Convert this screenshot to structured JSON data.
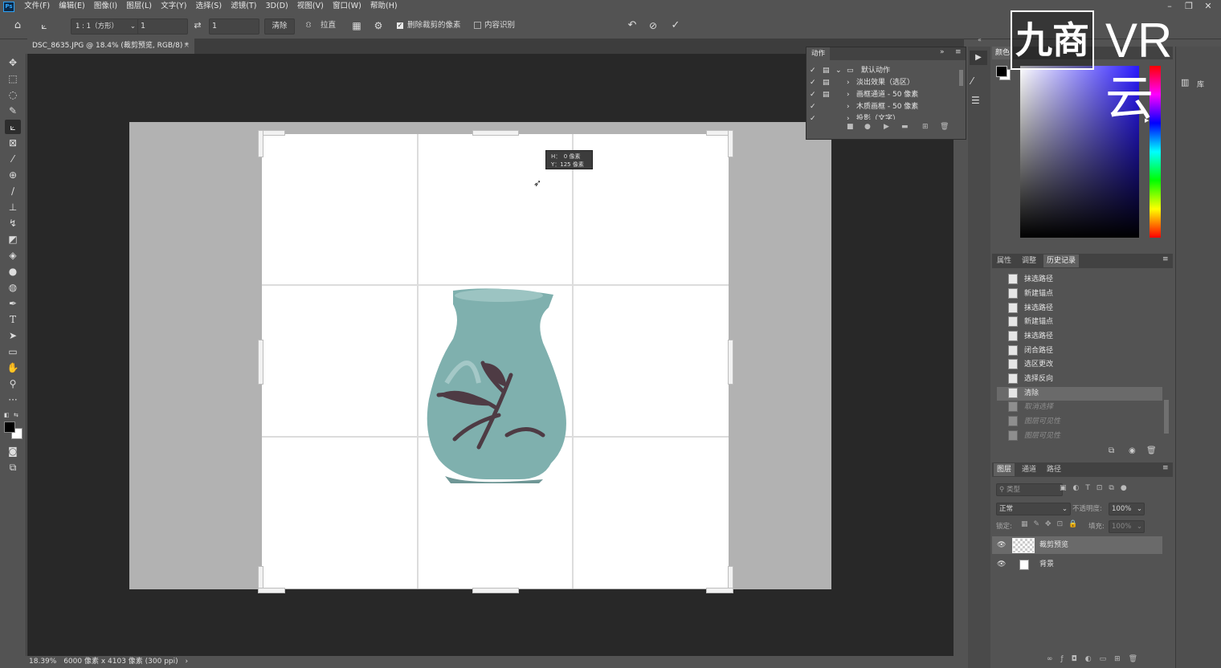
{
  "app": {
    "logo": "Ps"
  },
  "menu": [
    "文件(F)",
    "编辑(E)",
    "图像(I)",
    "图层(L)",
    "文字(Y)",
    "选择(S)",
    "滤镜(T)",
    "3D(D)",
    "视图(V)",
    "窗口(W)",
    "帮助(H)"
  ],
  "options": {
    "ratio_label": "1 : 1（方形）",
    "ratio_w": "1",
    "ratio_h": "1",
    "clear_label": "清除",
    "straighten_label": "拉直",
    "delete_cropped_label": "删除裁剪的像素",
    "delete_cropped_checked": true,
    "content_aware_label": "内容识别",
    "content_aware_checked": false
  },
  "document": {
    "tab_label": "DSC_8635.JPG @ 18.4% (裁剪预览, RGB/8) *",
    "tooltip_line1": "H：　0 像素",
    "tooltip_line2": "Y：125 像素"
  },
  "status": {
    "zoom": "18.39%",
    "info": "6000 像素 x 4103 像素 (300 ppi)"
  },
  "actions_panel": {
    "title": "动作",
    "rows": [
      {
        "label": "默认动作",
        "checked": true,
        "type": "folder"
      },
      {
        "label": "淡出效果（选区）",
        "checked": true,
        "type": "action"
      },
      {
        "label": "画框通道 - 50 像素",
        "checked": true,
        "type": "action"
      },
      {
        "label": "木质画框 - 50 像素",
        "checked": true,
        "type": "action"
      },
      {
        "label": "投影（文字）",
        "checked": true,
        "type": "action"
      }
    ]
  },
  "color_panel": {
    "tabs": [
      "颜色"
    ],
    "fg": "#000000",
    "bg": "#ffffff"
  },
  "watermark": {
    "text_left": "九商",
    "text_right": "VR云"
  },
  "history_panel": {
    "tabs": [
      "属性",
      "调整",
      "历史记录"
    ],
    "active_tab": "历史记录",
    "rows": [
      {
        "label": "抹选路径",
        "state": "normal"
      },
      {
        "label": "新建锚点",
        "state": "normal"
      },
      {
        "label": "抹选路径",
        "state": "normal"
      },
      {
        "label": "新建锚点",
        "state": "normal"
      },
      {
        "label": "抹选路径",
        "state": "normal"
      },
      {
        "label": "闭合路径",
        "state": "normal"
      },
      {
        "label": "选区更改",
        "state": "normal"
      },
      {
        "label": "选择反向",
        "state": "normal"
      },
      {
        "label": "清除",
        "state": "selected"
      },
      {
        "label": "取消选择",
        "state": "dim"
      },
      {
        "label": "图层可见性",
        "state": "dim"
      },
      {
        "label": "图层可见性",
        "state": "dim"
      }
    ]
  },
  "layers_panel": {
    "tabs": [
      "图层",
      "通道",
      "路径"
    ],
    "active_tab": "图层",
    "filter_placeholder": "类型",
    "blend_mode": "正常",
    "opacity_label": "不透明度:",
    "opacity_value": "100%",
    "lock_label": "锁定:",
    "fill_label": "填充:",
    "fill_value": "100%",
    "layers": [
      {
        "name": "裁剪预览",
        "visible": true,
        "selected": true
      },
      {
        "name": "背景",
        "visible": true,
        "selected": false
      }
    ]
  },
  "libraries": {
    "label": "库"
  }
}
